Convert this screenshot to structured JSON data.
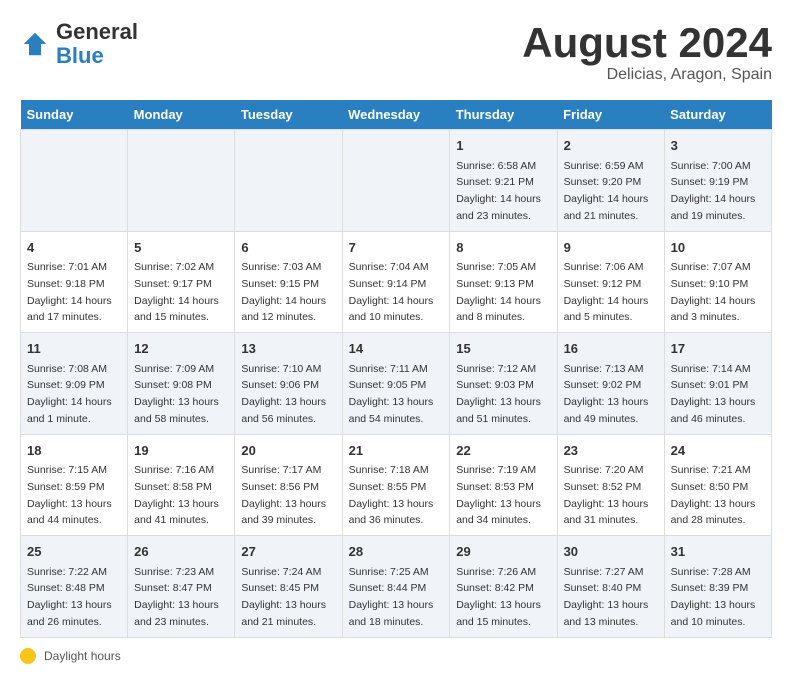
{
  "logo": {
    "general": "General",
    "blue": "Blue"
  },
  "title": "August 2024",
  "location": "Delicias, Aragon, Spain",
  "days_of_week": [
    "Sunday",
    "Monday",
    "Tuesday",
    "Wednesday",
    "Thursday",
    "Friday",
    "Saturday"
  ],
  "weeks": [
    [
      {
        "day": "",
        "info": ""
      },
      {
        "day": "",
        "info": ""
      },
      {
        "day": "",
        "info": ""
      },
      {
        "day": "",
        "info": ""
      },
      {
        "day": "1",
        "info": "Sunrise: 6:58 AM\nSunset: 9:21 PM\nDaylight: 14 hours and 23 minutes."
      },
      {
        "day": "2",
        "info": "Sunrise: 6:59 AM\nSunset: 9:20 PM\nDaylight: 14 hours and 21 minutes."
      },
      {
        "day": "3",
        "info": "Sunrise: 7:00 AM\nSunset: 9:19 PM\nDaylight: 14 hours and 19 minutes."
      }
    ],
    [
      {
        "day": "4",
        "info": "Sunrise: 7:01 AM\nSunset: 9:18 PM\nDaylight: 14 hours and 17 minutes."
      },
      {
        "day": "5",
        "info": "Sunrise: 7:02 AM\nSunset: 9:17 PM\nDaylight: 14 hours and 15 minutes."
      },
      {
        "day": "6",
        "info": "Sunrise: 7:03 AM\nSunset: 9:15 PM\nDaylight: 14 hours and 12 minutes."
      },
      {
        "day": "7",
        "info": "Sunrise: 7:04 AM\nSunset: 9:14 PM\nDaylight: 14 hours and 10 minutes."
      },
      {
        "day": "8",
        "info": "Sunrise: 7:05 AM\nSunset: 9:13 PM\nDaylight: 14 hours and 8 minutes."
      },
      {
        "day": "9",
        "info": "Sunrise: 7:06 AM\nSunset: 9:12 PM\nDaylight: 14 hours and 5 minutes."
      },
      {
        "day": "10",
        "info": "Sunrise: 7:07 AM\nSunset: 9:10 PM\nDaylight: 14 hours and 3 minutes."
      }
    ],
    [
      {
        "day": "11",
        "info": "Sunrise: 7:08 AM\nSunset: 9:09 PM\nDaylight: 14 hours and 1 minute."
      },
      {
        "day": "12",
        "info": "Sunrise: 7:09 AM\nSunset: 9:08 PM\nDaylight: 13 hours and 58 minutes."
      },
      {
        "day": "13",
        "info": "Sunrise: 7:10 AM\nSunset: 9:06 PM\nDaylight: 13 hours and 56 minutes."
      },
      {
        "day": "14",
        "info": "Sunrise: 7:11 AM\nSunset: 9:05 PM\nDaylight: 13 hours and 54 minutes."
      },
      {
        "day": "15",
        "info": "Sunrise: 7:12 AM\nSunset: 9:03 PM\nDaylight: 13 hours and 51 minutes."
      },
      {
        "day": "16",
        "info": "Sunrise: 7:13 AM\nSunset: 9:02 PM\nDaylight: 13 hours and 49 minutes."
      },
      {
        "day": "17",
        "info": "Sunrise: 7:14 AM\nSunset: 9:01 PM\nDaylight: 13 hours and 46 minutes."
      }
    ],
    [
      {
        "day": "18",
        "info": "Sunrise: 7:15 AM\nSunset: 8:59 PM\nDaylight: 13 hours and 44 minutes."
      },
      {
        "day": "19",
        "info": "Sunrise: 7:16 AM\nSunset: 8:58 PM\nDaylight: 13 hours and 41 minutes."
      },
      {
        "day": "20",
        "info": "Sunrise: 7:17 AM\nSunset: 8:56 PM\nDaylight: 13 hours and 39 minutes."
      },
      {
        "day": "21",
        "info": "Sunrise: 7:18 AM\nSunset: 8:55 PM\nDaylight: 13 hours and 36 minutes."
      },
      {
        "day": "22",
        "info": "Sunrise: 7:19 AM\nSunset: 8:53 PM\nDaylight: 13 hours and 34 minutes."
      },
      {
        "day": "23",
        "info": "Sunrise: 7:20 AM\nSunset: 8:52 PM\nDaylight: 13 hours and 31 minutes."
      },
      {
        "day": "24",
        "info": "Sunrise: 7:21 AM\nSunset: 8:50 PM\nDaylight: 13 hours and 28 minutes."
      }
    ],
    [
      {
        "day": "25",
        "info": "Sunrise: 7:22 AM\nSunset: 8:48 PM\nDaylight: 13 hours and 26 minutes."
      },
      {
        "day": "26",
        "info": "Sunrise: 7:23 AM\nSunset: 8:47 PM\nDaylight: 13 hours and 23 minutes."
      },
      {
        "day": "27",
        "info": "Sunrise: 7:24 AM\nSunset: 8:45 PM\nDaylight: 13 hours and 21 minutes."
      },
      {
        "day": "28",
        "info": "Sunrise: 7:25 AM\nSunset: 8:44 PM\nDaylight: 13 hours and 18 minutes."
      },
      {
        "day": "29",
        "info": "Sunrise: 7:26 AM\nSunset: 8:42 PM\nDaylight: 13 hours and 15 minutes."
      },
      {
        "day": "30",
        "info": "Sunrise: 7:27 AM\nSunset: 8:40 PM\nDaylight: 13 hours and 13 minutes."
      },
      {
        "day": "31",
        "info": "Sunrise: 7:28 AM\nSunset: 8:39 PM\nDaylight: 13 hours and 10 minutes."
      }
    ]
  ],
  "legend": {
    "icon_label": "sun-icon",
    "text": "Daylight hours"
  }
}
